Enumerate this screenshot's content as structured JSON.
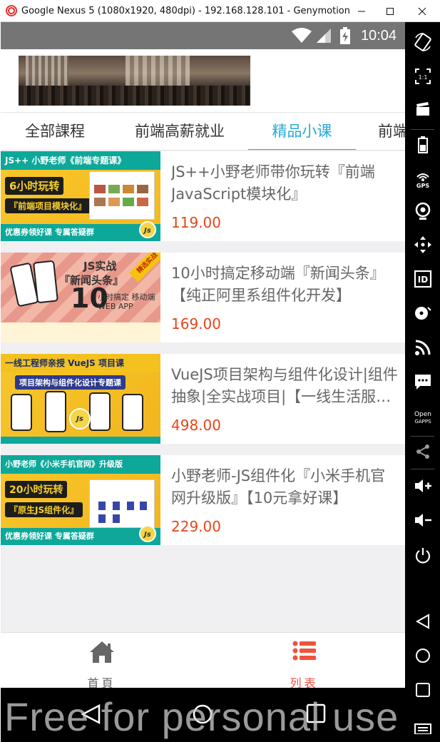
{
  "window": {
    "title": "Google Nexus 5 (1080x1920, 480dpi) - 192.168.128.101 - Genymotion",
    "controls": [
      "minimize",
      "maximize",
      "close"
    ]
  },
  "statusbar": {
    "time": "10:04"
  },
  "tabs": [
    {
      "label": "全部課程",
      "active": false
    },
    {
      "label": "前端高薪就业",
      "active": false
    },
    {
      "label": "精品小课",
      "active": true
    },
    {
      "label": "前端",
      "active": false
    }
  ],
  "courses": [
    {
      "title": "JS++小野老师带你玩转『前端JavaScript模块化』",
      "price": "119.00",
      "thumb": {
        "top": "JS++ 小野老师《前端专题课》",
        "badge1": "6小时玩转",
        "badge2": "『前端项目模块化』",
        "bottom": "优惠券领好课 专属答疑群"
      }
    },
    {
      "title": "10小时搞定移动端『新闻头条』【纯正阿里系组件化开发】",
      "price": "169.00",
      "thumb": {
        "head": "JS实战",
        "head2": "『新闻头条』",
        "num": "10",
        "sub": "小时搞定 移动端 WEB APP",
        "ribbon": "精选实战"
      }
    },
    {
      "title": "VueJS项目架构与组件化设计|组件抽象|全实战项目|【一线生活服务类】",
      "price": "498.00",
      "thumb": {
        "top": "一线工程师亲授 VueJS 项目课",
        "sub": "项目架构与组件化设计专题课"
      }
    },
    {
      "title": "小野老师-JS组件化『小米手机官网升级版』【10元拿好课】",
      "price": "229.00",
      "thumb": {
        "top": "小野老师《小米手机官网》升级版",
        "badge1": "20小时玩转",
        "badge2": "『原生JS组件化』",
        "bottom": "优惠券领好课 专属答疑群"
      }
    }
  ],
  "bottomnav": [
    {
      "label": "首頁",
      "icon": "home-icon",
      "active": false
    },
    {
      "label": "列表",
      "icon": "list-icon",
      "active": true
    }
  ],
  "colors": {
    "accent": "#2aa8d8",
    "price": "#e5461b",
    "nav_active": "#f0533d",
    "nav_inactive": "#666666"
  },
  "sidebar": [
    "rotate",
    "pixel-perfect 1:1",
    "clapper",
    "battery",
    "GPS",
    "webcam",
    "dpad",
    "ID",
    "disk",
    "rss",
    "sms",
    "Open GAPPS",
    "share",
    "volume up",
    "volume down",
    "power",
    "back",
    "home",
    "recents",
    "menu"
  ],
  "watermark": "Free for personal use"
}
